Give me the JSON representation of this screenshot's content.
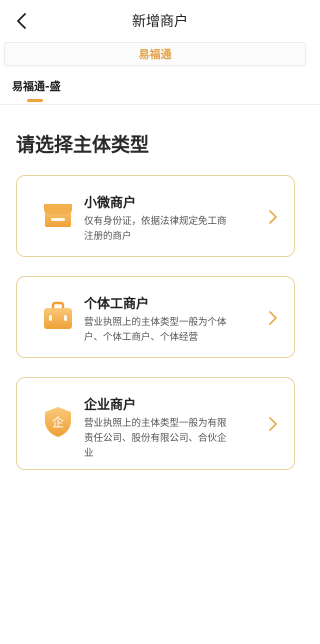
{
  "header": {
    "title": "新增商户"
  },
  "brand": {
    "label": "易福通"
  },
  "tabs": [
    {
      "label": "易福通-盛",
      "active": true
    }
  ],
  "section_title": "请选择主体类型",
  "cards": [
    {
      "title": "小微商户",
      "description": "仅有身份证，依据法律规定免工商注册的商户",
      "icon": "shop-icon"
    },
    {
      "title": "个体工商户",
      "description": "营业执照上的主体类型一般为个体户、个体工商户、个体经营",
      "icon": "briefcase-icon"
    },
    {
      "title": "企业商户",
      "description": "营业执照上的主体类型一般为有限责任公司、股份有限公司、合伙企业",
      "icon": "shield-qi-icon"
    }
  ],
  "icon_glyphs": {
    "shield_char": "企"
  },
  "colors": {
    "accent": "#f1a23c",
    "accent_light": "#f7c778",
    "card_border": "#e8d29f",
    "brand_text": "#e2a44d"
  }
}
